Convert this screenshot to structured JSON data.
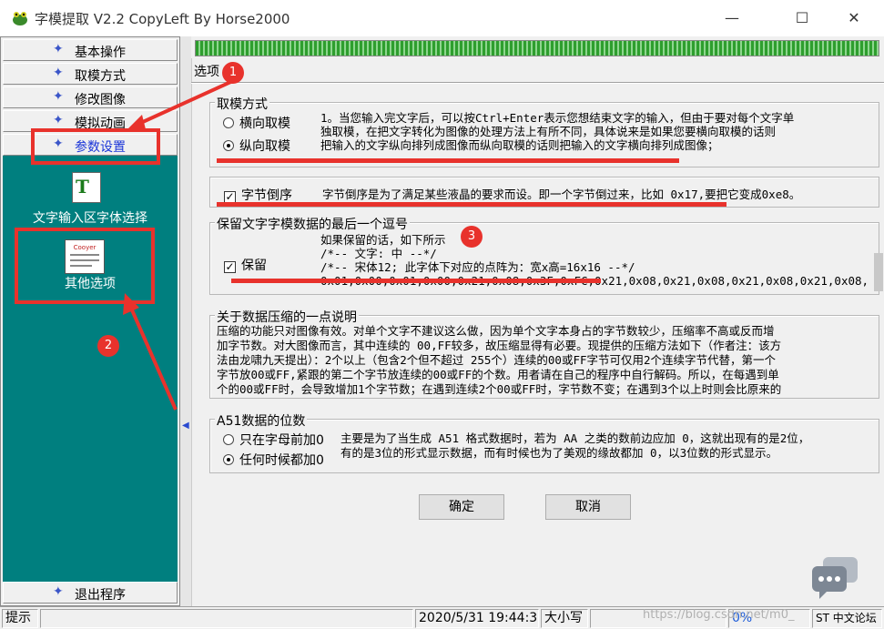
{
  "window": {
    "title": "字模提取 V2.2  CopyLeft By Horse2000",
    "minimize_glyph": "—",
    "maximize_glyph": "☐",
    "close_glyph": "✕",
    "icon": "frog-app-icon"
  },
  "sidebar": {
    "star_glyph": "✦",
    "items": [
      {
        "label": "基本操作"
      },
      {
        "label": "取模方式"
      },
      {
        "label": "修改图像"
      },
      {
        "label": "模拟动画"
      },
      {
        "label": "参数设置"
      }
    ],
    "exit_label": "退出程序",
    "panel": {
      "font_icon_text": "T",
      "font_select_label": "文字输入区字体选择",
      "other_options_icon_text": "Cooyer",
      "other_options_label": "其他选项"
    }
  },
  "dialog": {
    "title": "选项",
    "group_mode": {
      "legend": "取模方式",
      "options": [
        "横向取模",
        "纵向取模"
      ],
      "selected": "纵向取模",
      "desc": [
        "1。当您输入完文字后，可以按Ctrl+Enter表示您想结束文字的输入，但由于要对每个文字单",
        "独取模，在把文字转化为图像的处理方法上有所不同，具体说来是如果您要横向取模的话则",
        "把输入的文字纵向排列成图像而纵向取模的话则把输入的文字横向排列成图像；"
      ]
    },
    "group_reverse": {
      "label": "字节倒序",
      "checked": true,
      "desc": "字节倒序是为了满足某些液晶的要求而设。即一个字节倒过来，比如 0x17,要把它变成0xe8。"
    },
    "group_comma": {
      "legend": "保留文字字模数据的最后一个逗号",
      "label": "保留",
      "checked": true,
      "desc": [
        "如果保留的话，如下所示",
        "/*--  文字:  中  --*/",
        "/*--  宋体12;  此字体下对应的点阵为：宽x高=16x16   --*/",
        "0x01,0x00,0x01,0x00,0x21,0x08,0x3F,0xFC,0x21,0x08,0x21,0x08,0x21,0x08,0x21,0x08,"
      ]
    },
    "group_compress": {
      "legend": "关于数据压缩的一点说明",
      "text": [
        "压缩的功能只对图像有效。对单个文字不建议这么做，因为单个文字本身占的字节数较少，压缩率不高或反而增",
        "加字节数。对大图像而言，其中连续的 00,FF较多，故压缩显得有必要。现提供的压缩方法如下（作者注：该方",
        "法由龙啸九天提出）：2个以上（包含2个但不超过 255个）连续的00或FF字节可仅用2个连续字节代替，第一个",
        "字节放00或FF,紧跟的第二个字节放连续的00或FF的个数。用者请在自己的程序中自行解码。所以，在每遇到单",
        "个的00或FF时，会导致增加1个字节数；在遇到连续2个00或FF时，字节数不变；在遇到3个以上时则会比原来的"
      ]
    },
    "group_a51": {
      "legend": "A51数据的位数",
      "options": [
        "只在字母前加0",
        "任何时候都加0"
      ],
      "selected": "任何时候都加0",
      "desc": [
        "主要是为了当生成 A51 格式数据时，若为 AA 之类的数前边应加 0，这就出现有的是2位，",
        "有的是3位的形式显示数据，而有时候也为了美观的缘故都加 0，以3位数的形式显示。"
      ]
    },
    "ok_label": "确定",
    "cancel_label": "取消"
  },
  "statusbar": {
    "hint": "提示",
    "datetime": "2020/5/31 19:44:33",
    "caps": "大小写",
    "progress": "0%",
    "ime": "ST 中文论坛"
  },
  "watermark": "https://blog.csdn.net/m0_",
  "annotations": [
    "1",
    "2",
    "3"
  ],
  "colors": {
    "teal_panel": "#007f7f",
    "annotation_red": "#e8322c",
    "active_item": "#1a35d8",
    "progress_green": "#2e9e2e"
  }
}
